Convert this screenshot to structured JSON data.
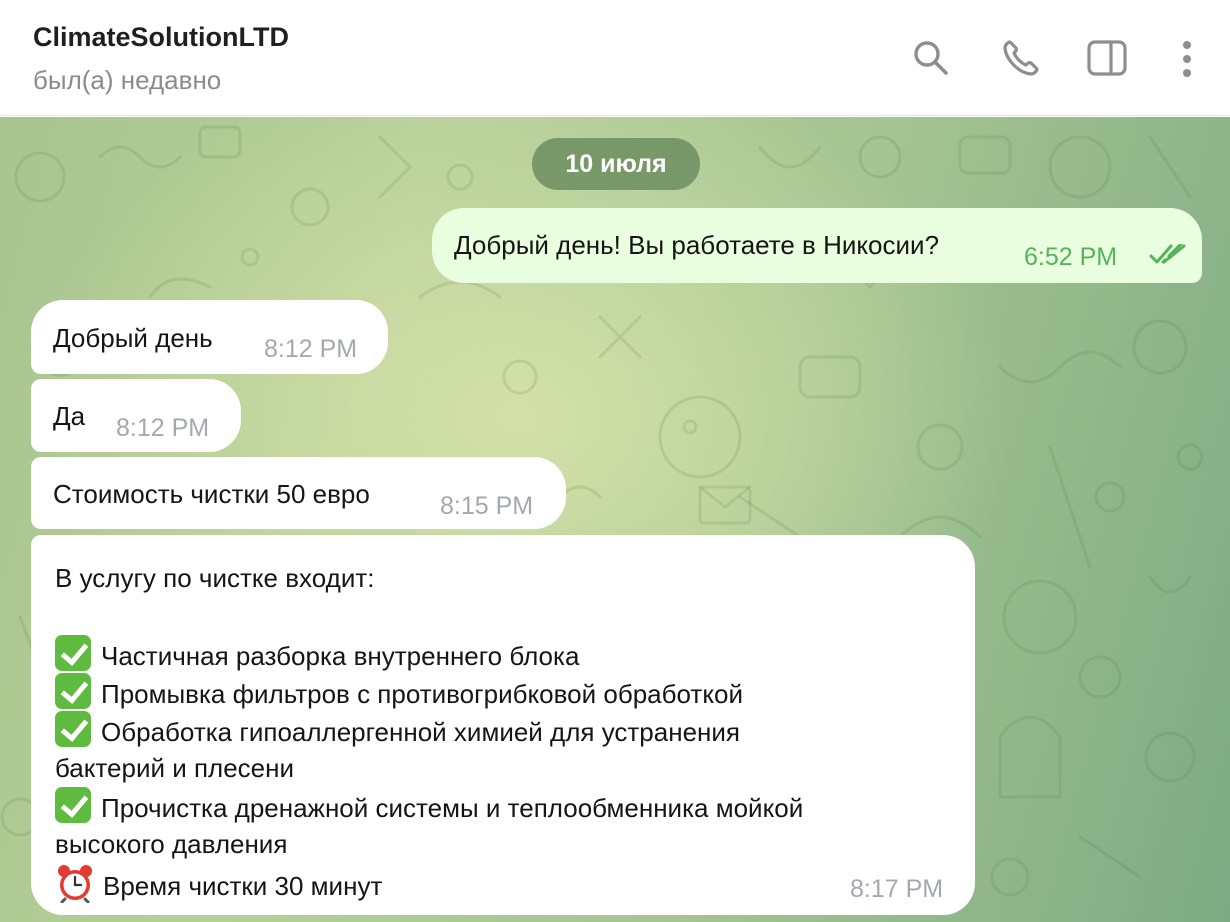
{
  "header": {
    "title": "ClimateSolutionLTD",
    "status": "был(а) недавно",
    "icons": [
      "search-icon",
      "phone-icon",
      "sidebar-panel-icon",
      "more-vertical-icon"
    ]
  },
  "chat": {
    "date_label": "10 июля",
    "messages": [
      {
        "direction": "out",
        "text": "Добрый день! Вы работаете в Никосии?",
        "time": "6:52 PM",
        "status": "read"
      },
      {
        "direction": "in",
        "text": "Добрый день",
        "time": "8:12 PM"
      },
      {
        "direction": "in",
        "text": "Да",
        "time": "8:12 PM"
      },
      {
        "direction": "in",
        "text": "Стоимость чистки 50 евро",
        "time": "8:15 PM"
      },
      {
        "direction": "in",
        "time": "8:17 PM",
        "intro": "В услугу по чистке входит:",
        "items": [
          {
            "icon": "check-emoji",
            "lines": [
              "Частичная разборка внутреннего блока"
            ]
          },
          {
            "icon": "check-emoji",
            "lines": [
              "Промывка фильтров с противогрибковой обработкой"
            ]
          },
          {
            "icon": "check-emoji",
            "lines": [
              "Обработка гипоаллергенной химией для устранения",
              "бактерий и плесени"
            ]
          },
          {
            "icon": "check-emoji",
            "lines": [
              "Прочистка дренажной системы и теплообменника мойкой",
              "высокого давления"
            ]
          },
          {
            "icon": "alarm-clock-emoji",
            "lines": [
              "Время чистки 30 минут"
            ]
          }
        ]
      }
    ]
  },
  "colors": {
    "incoming_bubble": "#ffffff",
    "outgoing_bubble": "#eaffdf",
    "outgoing_time": "#55b35a",
    "date_pill": "#6b8f5e",
    "background_green": "#a9c58f"
  }
}
